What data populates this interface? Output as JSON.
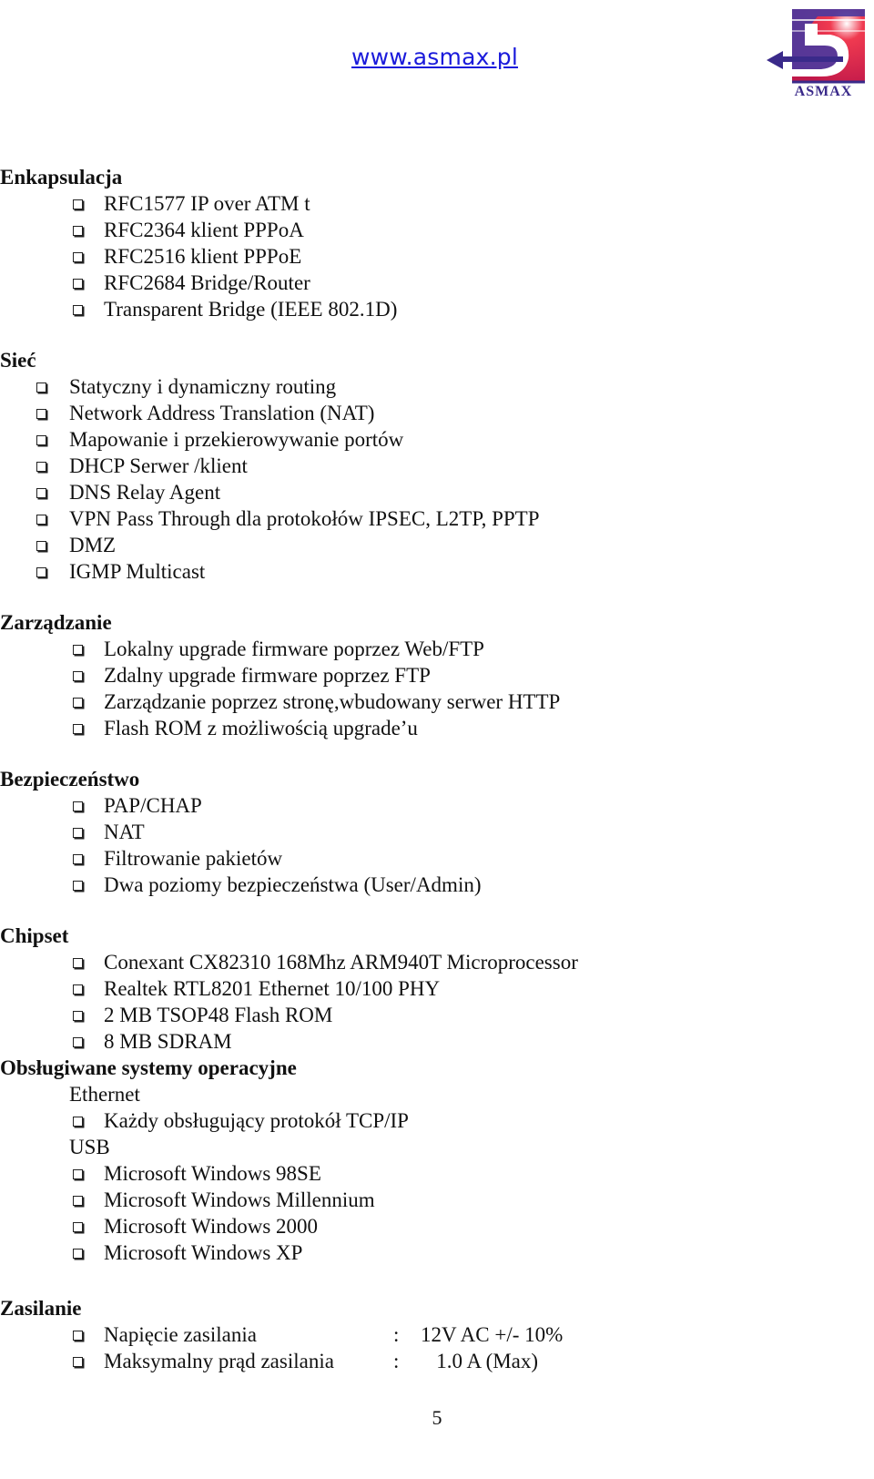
{
  "header": {
    "site_link": "www.asmax.pl",
    "logo_text": "ASMAX",
    "brand_colors": {
      "link": "#1a1adb",
      "logo_blue": "#3a2a8a",
      "logo_red": "#e0203a"
    }
  },
  "sections": {
    "encapsulation": {
      "title": "Enkapsulacja",
      "items": [
        "RFC1577 IP over ATM t",
        "RFC2364 klient PPPoA",
        "RFC2516 klient PPPoE",
        "RFC2684 Bridge/Router",
        "Transparent Bridge (IEEE 802.1D)"
      ]
    },
    "network": {
      "title": "Sieć",
      "items": [
        "Statyczny i dynamiczny routing",
        "Network Address Translation (NAT)",
        "Mapowanie i przekierowywanie portów",
        "DHCP Serwer /klient",
        "DNS Relay Agent",
        "VPN Pass Through dla protokołów IPSEC, L2TP, PPTP",
        "DMZ",
        "IGMP Multicast"
      ]
    },
    "management": {
      "title": "Zarządzanie",
      "items": [
        "Lokalny upgrade firmware poprzez Web/FTP",
        "Zdalny upgrade firmware poprzez FTP",
        "Zarządzanie poprzez stronę,wbudowany serwer HTTP",
        "Flash ROM z możliwością upgrade’u"
      ]
    },
    "security": {
      "title": "Bezpieczeństwo",
      "items": [
        "PAP/CHAP",
        "NAT",
        "Filtrowanie pakietów",
        "Dwa poziomy bezpieczeństwa (User/Admin)"
      ]
    },
    "chipset": {
      "title": "Chipset",
      "items": [
        "Conexant CX82310 168Mhz ARM940T Microprocessor",
        "Realtek RTL8201 Ethernet 10/100 PHY",
        "2 MB TSOP48 Flash ROM",
        "8 MB SDRAM"
      ]
    },
    "os": {
      "title": "Obsługiwane systemy operacyjne",
      "ethernet_label": "Ethernet",
      "ethernet_items": [
        "Każdy obsługujący protokół TCP/IP"
      ],
      "usb_label": "USB",
      "usb_items": [
        "Microsoft Windows 98SE",
        "Microsoft Windows Millennium",
        "Microsoft Windows 2000",
        "Microsoft Windows XP"
      ]
    },
    "power": {
      "title": "Zasilanie",
      "rows": [
        {
          "label": "Napięcie zasilania",
          "separator": ":",
          "value": "12V AC +/- 10%"
        },
        {
          "label": "Maksymalny prąd zasilania",
          "separator": ":",
          "value": "   1.0 A (Max)"
        }
      ]
    }
  },
  "footer": {
    "page_number": "5"
  }
}
